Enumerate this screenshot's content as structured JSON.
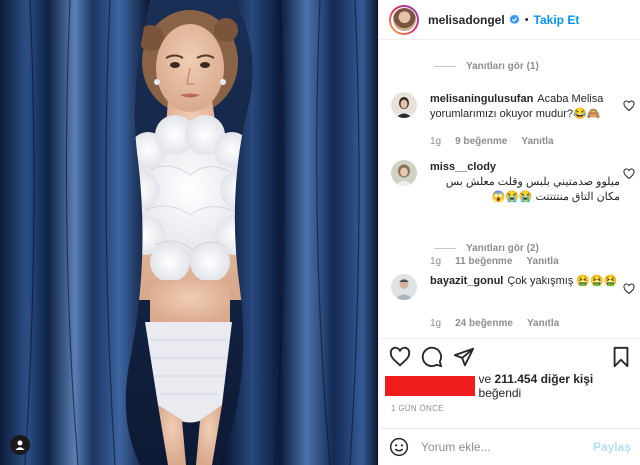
{
  "header": {
    "username": "melisadongel",
    "dot": "•",
    "follow_label": "Takip Et"
  },
  "comments": {
    "replies_1": "Yanıtları gör (1)",
    "replies_2": "Yanıtları gör (2)",
    "items": [
      {
        "user": "melisaningulusufan",
        "text": "Acaba Melisa yorumlarımızı okuyor mudur?😂🙈",
        "time": "1g",
        "likes": "9 beğenme",
        "reply": "Yanıtla"
      },
      {
        "user": "miss__clody",
        "text": "ميلوو صدمتيني بلبس وقلت معلش بس مكان التاق منتتتتت 😭😭😱",
        "time": "1g",
        "likes": "11 beğenme",
        "reply": "Yanıtla"
      },
      {
        "user": "bayazit_gonul",
        "text": "Çok yakışmış 🤮🤮🤮",
        "time": "1g",
        "likes": "24 beğenme",
        "reply": "Yanıtla"
      }
    ]
  },
  "likes": {
    "prefix": "ve ",
    "count": "211.454 diğer kişi",
    "suffix": " beğendi"
  },
  "timestamp": "1 GÜN ÖNCE",
  "composer": {
    "placeholder": "Yorum ekle...",
    "post_label": "Paylaş"
  },
  "colors": {
    "accent": "#0095f6",
    "redaction": "#ee1c1c",
    "curtain": "#1f3d6e"
  }
}
